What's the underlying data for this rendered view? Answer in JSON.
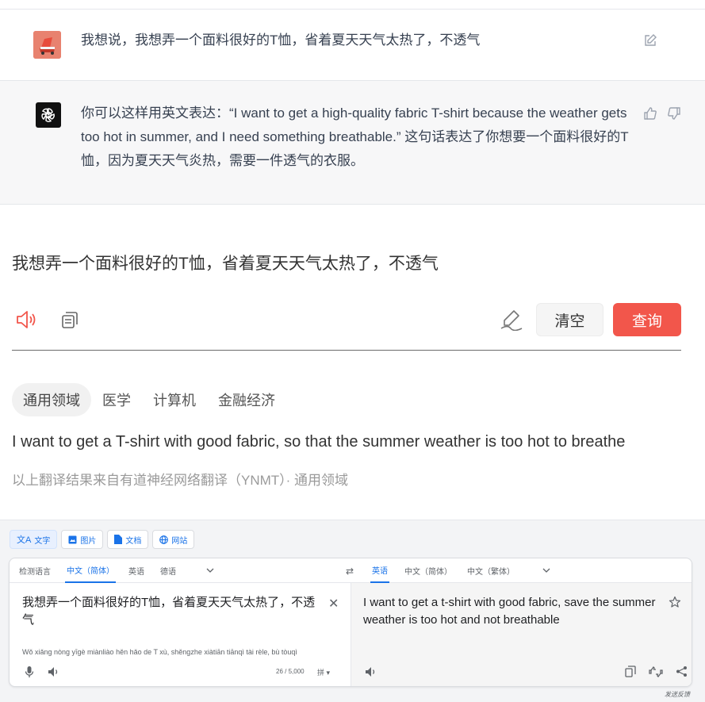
{
  "chat": {
    "user_message": "我想说，我想弄一个面料很好的T恤，省着夏天天气太热了，不透气",
    "bot_message": "你可以这样用英文表达：“I want to get a high-quality fabric T-shirt because the weather gets too hot in summer, and I need something breathable.” 这句话表达了你想要一个面料很好的T恤，因为夏天天气炎热，需要一件透气的衣服。",
    "icons": [
      "edit-icon",
      "thumb-up-icon",
      "thumb-down-icon",
      "openai-logo-icon"
    ]
  },
  "youdao": {
    "input_text": "我想弄一个面料很好的T恤，省着夏天天气太热了，不透气",
    "clear_label": "清空",
    "query_label": "查询",
    "domain_tabs": [
      {
        "label": "通用领域",
        "active": true
      },
      {
        "label": "医学",
        "active": false
      },
      {
        "label": "计算机",
        "active": false
      },
      {
        "label": "金融经济",
        "active": false
      }
    ],
    "result": "I want to get a T-shirt with good fabric, so that the summer weather is too hot to breathe",
    "source_note": "以上翻译结果来自有道神经网络翻译（YNMT）· 通用领域",
    "accent_color": "#f2564b"
  },
  "google": {
    "modes": [
      {
        "label": "文字",
        "icon": "translate-icon",
        "active": true
      },
      {
        "label": "图片",
        "icon": "image-icon",
        "active": false
      },
      {
        "label": "文档",
        "icon": "document-icon",
        "active": false
      },
      {
        "label": "网站",
        "icon": "globe-icon",
        "active": false
      }
    ],
    "source_langs": [
      "检测语言",
      "中文（简体）",
      "英语",
      "德语"
    ],
    "target_langs": [
      "英语",
      "中文（简体）",
      "中文（繁体）"
    ],
    "source_text": "我想弄一个面料很好的T恤，省着夏天天气太热了，不透气",
    "pinyin": "Wǒ xiǎng nòng yīgè miànliào hěn hǎo de T xù, shěngzhe xiàtiān tiānqì tài rèle, bù tòuqì",
    "char_count": "26 / 5,000",
    "ime_label": "拼",
    "target_text": "I want to get a t-shirt with good fabric, save the summer weather is too hot and not breathable",
    "send_feedback": "发送反馈",
    "accent_color": "#1a73e8"
  }
}
